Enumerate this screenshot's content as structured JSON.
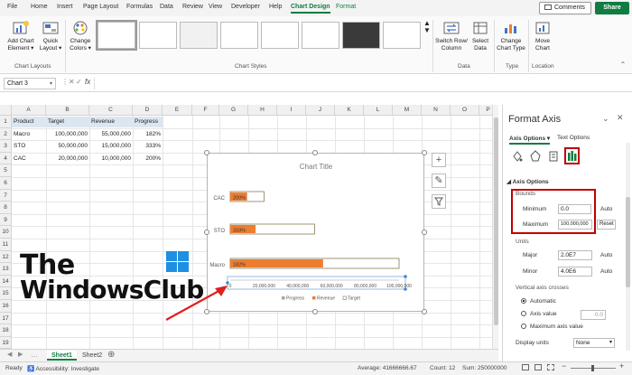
{
  "ribbon_tabs": [
    "File",
    "Home",
    "Insert",
    "Page Layout",
    "Formulas",
    "Data",
    "Review",
    "View",
    "Developer",
    "Help",
    "Chart Design",
    "Format"
  ],
  "active_tab": "Chart Design",
  "header_buttons": {
    "comments": "Comments",
    "share": "Share"
  },
  "ribbon": {
    "add_chart_element": "Add Chart Element ▾",
    "quick_layout": "Quick Layout ▾",
    "change_colors": "Change Colors ▾",
    "switch_row_column": "Switch Row/ Column",
    "select_data": "Select Data",
    "change_chart_type": "Change Chart Type",
    "move_chart": "Move Chart",
    "groups": {
      "chart_layouts": "Chart Layouts",
      "chart_styles": "Chart Styles",
      "data": "Data",
      "type": "Type",
      "location": "Location"
    }
  },
  "formula_bar": {
    "name_box": "Chart 3",
    "fx": "fx"
  },
  "columns": [
    "A",
    "B",
    "C",
    "D",
    "E",
    "F",
    "G",
    "H",
    "I",
    "J",
    "K",
    "L",
    "M",
    "N",
    "O",
    "P"
  ],
  "rows": [
    "1",
    "2",
    "3",
    "4",
    "5",
    "6",
    "7",
    "8",
    "9",
    "10",
    "11",
    "12",
    "13",
    "14",
    "15",
    "16",
    "17",
    "18",
    "19"
  ],
  "table": {
    "headers": [
      "Product",
      "Target",
      "Revenue",
      "Progress"
    ],
    "rows": [
      [
        "Macro",
        "100,000,000",
        "55,000,000",
        "182%"
      ],
      [
        "STO",
        "50,000,000",
        "15,000,000",
        "333%"
      ],
      [
        "CAC",
        "20,000,000",
        "10,000,000",
        "200%"
      ]
    ]
  },
  "chart_data": {
    "type": "bar",
    "title": "Chart Title",
    "orientation": "horizontal",
    "categories": [
      "CAC",
      "STO",
      "Macro"
    ],
    "series": [
      {
        "name": "Progress",
        "values": [
          2.0,
          3.33,
          1.82
        ]
      },
      {
        "name": "Revenue",
        "values": [
          10000000,
          15000000,
          55000000
        ]
      },
      {
        "name": "Target",
        "values": [
          20000000,
          50000000,
          100000000
        ]
      }
    ],
    "data_labels": [
      "200%",
      "333%",
      "182%"
    ],
    "x_ticks": [
      "0",
      "20,000,000",
      "40,000,000",
      "60,000,000",
      "80,000,000",
      "100,000,000"
    ],
    "xlim": [
      0,
      100000000
    ],
    "legend_position": "bottom",
    "colors": {
      "Progress": "#a5a5a5",
      "Revenue": "#ed7d31",
      "Target": "#ffffff"
    }
  },
  "format_pane": {
    "title": "Format Axis",
    "tabs": [
      "Axis Options ▾",
      "Text Options"
    ],
    "section": "Axis Options",
    "bounds": "Bounds",
    "minimum_label": "Minimum",
    "minimum_value": "0.0",
    "minimum_auto": "Auto",
    "maximum_label": "Maximum",
    "maximum_value": "100,000,000",
    "maximum_reset": "Reset",
    "units": "Units",
    "major_label": "Major",
    "major_value": "2.0E7",
    "major_auto": "Auto",
    "minor_label": "Minor",
    "minor_value": "4.0E6",
    "minor_auto": "Auto",
    "vertical_crosses": "Vertical axis crosses",
    "automatic": "Automatic",
    "axis_value": "Axis value",
    "axis_value_input": "0.0",
    "max_axis_value": "Maximum axis value",
    "display_units": "Display units",
    "display_units_value": "None"
  },
  "sheets": [
    "Sheet1",
    "Sheet2"
  ],
  "active_sheet": "Sheet1",
  "status": {
    "ready": "Ready",
    "accessibility": "Accessibility: Investigate",
    "average": "Average: 41666666.67",
    "count": "Count: 12",
    "sum": "Sum: 250000000"
  },
  "watermark": {
    "line1": "The",
    "line2": "WindowsClub"
  }
}
